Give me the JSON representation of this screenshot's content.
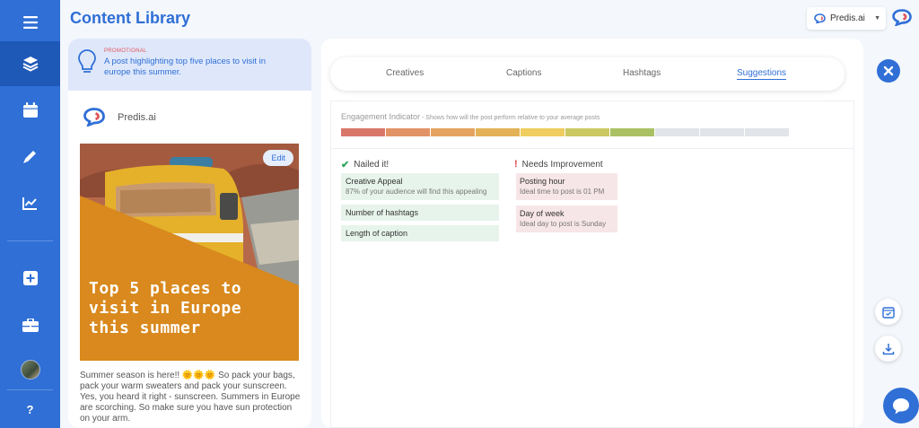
{
  "header": {
    "title": "Content Library"
  },
  "brand_selector": {
    "selected": "Predis.ai"
  },
  "sidebar": {
    "items": [
      {
        "name": "menu-icon"
      },
      {
        "name": "content-library-icon"
      },
      {
        "name": "calendar-icon"
      },
      {
        "name": "edit-icon"
      },
      {
        "name": "analytics-icon"
      },
      {
        "name": "add-icon"
      },
      {
        "name": "briefcase-icon"
      },
      {
        "name": "avatar"
      }
    ],
    "help_label": "?"
  },
  "post": {
    "tag": "PROMOTIONAL",
    "idea": "A post highlighting top five places to visit in europe this summer.",
    "brand_name": "Predis.ai",
    "edit_label": "Edit",
    "creative_line1": "Top 5 places to",
    "creative_line2": "visit in Europe",
    "creative_line3": "this summer",
    "caption": "Summer season is here!! 🌞🌞🌞 So pack your bags, pack your warm sweaters and pack your sunscreen. Yes, you heard it right - sunscreen. Summers in Europe are scorching. So make sure you have sun protection on your arm."
  },
  "tabs": [
    {
      "label": "Creatives"
    },
    {
      "label": "Captions"
    },
    {
      "label": "Hashtags"
    },
    {
      "label": "Suggestions",
      "active": true
    }
  ],
  "engagement": {
    "title": "Engagement Indicator",
    "subtitle": " - Shows how will the post perform relative to your average posts",
    "segments_total": 10,
    "segments_filled": 7,
    "colors": [
      "#d9776b",
      "#e29366",
      "#e5a35f",
      "#e3b257",
      "#efcd5f",
      "#cbc862",
      "#aac163",
      "#e1e4e8",
      "#e1e4e8",
      "#e1e4e8"
    ]
  },
  "nailed": {
    "heading": "Nailed it!",
    "items": [
      {
        "title": "Creative Appeal",
        "sub": "87% of your audience will find this appealing"
      },
      {
        "title": "Number of hashtags",
        "sub": ""
      },
      {
        "title": "Length of caption",
        "sub": ""
      }
    ]
  },
  "improve": {
    "heading": "Needs Improvement",
    "items": [
      {
        "title": "Posting hour",
        "sub": "Ideal time to post is 01 PM"
      },
      {
        "title": "Day of week",
        "sub": "Ideal day to post is Sunday"
      }
    ]
  },
  "colors": {
    "primary": "#2f6fd6",
    "sidebar_active": "#1f59b8",
    "good_bg": "#e7f4ec",
    "bad_bg": "#f7e6e7",
    "creative_orange": "#d9891d"
  }
}
